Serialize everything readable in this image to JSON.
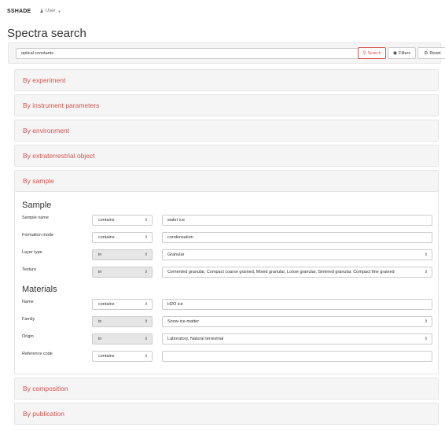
{
  "navbar": {
    "brand": "SSHADE",
    "user_label": "User"
  },
  "page_title": "Spectra search",
  "search": {
    "value": "optical constants",
    "search_label": "Search",
    "filters_label": "Filters",
    "reset_label": "Reset"
  },
  "panels": {
    "experiment": "By experiment",
    "instrument": "By instrument parameters",
    "environment": "By environment",
    "extraterrestrial": "By extraterrestrial object",
    "sample": "By sample",
    "composition": "By composition",
    "publication": "By publication"
  },
  "sample_section": {
    "title": "Sample",
    "rows": [
      {
        "label": "Sample name",
        "operator": "contains",
        "value": "water ice"
      },
      {
        "label": "Formation mode",
        "operator": "contains",
        "value": "condensation"
      },
      {
        "label": "Layer type",
        "operator": "in",
        "value": "Granular"
      },
      {
        "label": "Texture",
        "operator": "in",
        "value": "Cemented granular, Compact coarse grained, Mixed granular, Loose granular, Sintered granular, Compact fine grained"
      }
    ]
  },
  "materials_section": {
    "title": "Materials",
    "rows": [
      {
        "label": "Name",
        "operator": "contains",
        "value": "H2O ice"
      },
      {
        "label": "Family",
        "operator": "in",
        "value": "Snow-ice-matter"
      },
      {
        "label": "Origin",
        "operator": "in",
        "value": "Laboratory, Natural terrestrial"
      },
      {
        "label": "Reference code",
        "operator": "contains",
        "value": ""
      }
    ]
  },
  "colors": {
    "accent": "#d9534f",
    "panel_bg": "#f5f5f5",
    "disabled_bg": "#e6e6e6"
  }
}
